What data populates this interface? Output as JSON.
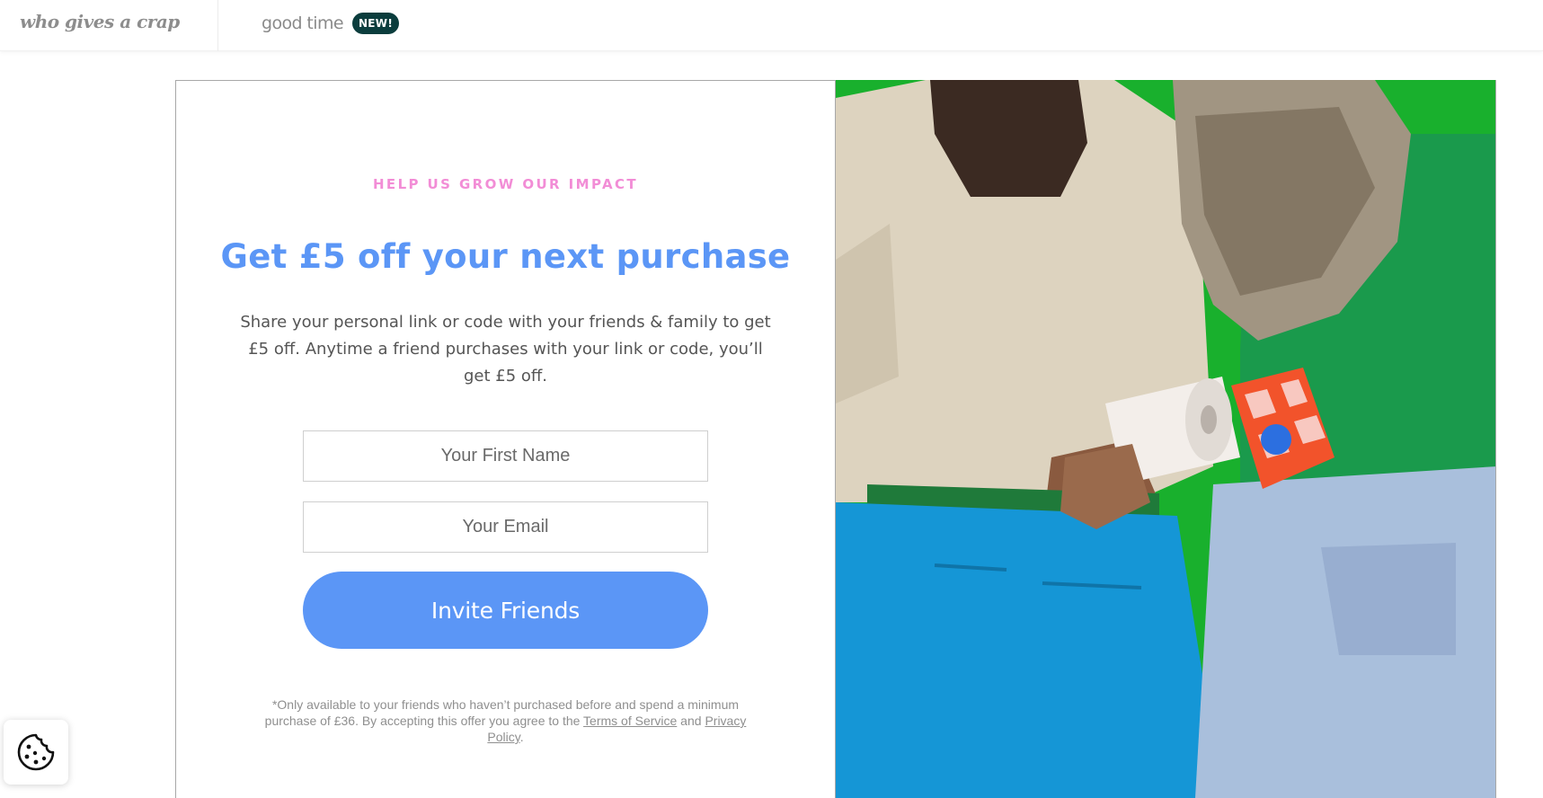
{
  "header": {
    "brand_text": "who gives a crap",
    "secondary_tab_label": "good time",
    "secondary_tab_badge": "NEW!"
  },
  "referral": {
    "eyebrow": "HELP US GROW OUR IMPACT",
    "headline": "Get £5 off your next purchase",
    "description": "Share your personal link or code with your friends & family to get £5 off. Anytime a friend purchases with your link or code, you’ll get £5 off.",
    "first_name_placeholder": "Your First Name",
    "first_name_value": "",
    "email_placeholder": "Your Email",
    "email_value": "",
    "invite_button_label": "Invite Friends",
    "disclaimer_prefix": "*Only available to your friends who haven’t purchased before and spend a minimum purchase of £36. By accepting this offer you agree to the ",
    "terms_link_label": "Terms of Service",
    "disclaimer_and": " and ",
    "privacy_link_label": "Privacy Policy",
    "disclaimer_suffix": "."
  },
  "hero_image": {
    "subject": "two people from behind holding toilet paper rolls"
  },
  "cookie_button": {
    "icon": "cookie-icon"
  },
  "colors": {
    "accent_blue": "#5b96f6",
    "eyebrow_pink": "#f28dd6",
    "badge_dark_teal": "#0b3d3d",
    "hero_green": "#19b02d"
  }
}
